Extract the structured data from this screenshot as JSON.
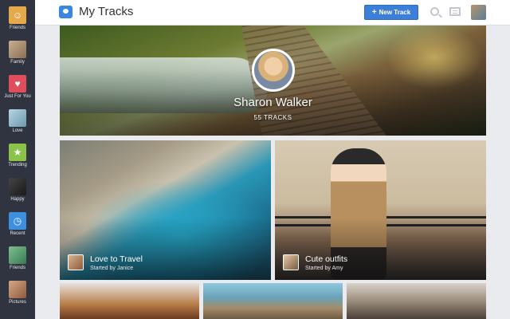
{
  "app": {
    "title": "My Tracks"
  },
  "sidebar": {
    "items": [
      {
        "label": "Friends",
        "icon": "friends-icon",
        "color": "#e5a94a"
      },
      {
        "label": "Family",
        "icon": "family-thumb",
        "color": "#b7a58b"
      },
      {
        "label": "Just For You",
        "icon": "heart-icon",
        "color": "#e04e5c"
      },
      {
        "label": "Love",
        "icon": "love-thumb",
        "color": "#8fb6c7"
      },
      {
        "label": "Trending",
        "icon": "star-icon",
        "color": "#8bc34a"
      },
      {
        "label": "Happy",
        "icon": "happy-thumb",
        "color": "#3a3a3a"
      },
      {
        "label": "Recent",
        "icon": "clock-icon",
        "color": "#3d8fe0"
      },
      {
        "label": "Friends",
        "icon": "friends-thumb",
        "color": "#58a070"
      },
      {
        "label": "Pictures",
        "icon": "pictures-thumb",
        "color": "#c58a6a"
      }
    ]
  },
  "toolbar": {
    "new_track_label": "New Track",
    "new_track_icon": "plus-icon",
    "accent": "#3d7fd8"
  },
  "hero": {
    "name": "Sharon Walker",
    "count": "55 TRACKS"
  },
  "cards": [
    {
      "title": "Love to Travel",
      "subtitle": "Started by Janice"
    },
    {
      "title": "Cute outfits",
      "subtitle": "Started by Amy"
    }
  ]
}
